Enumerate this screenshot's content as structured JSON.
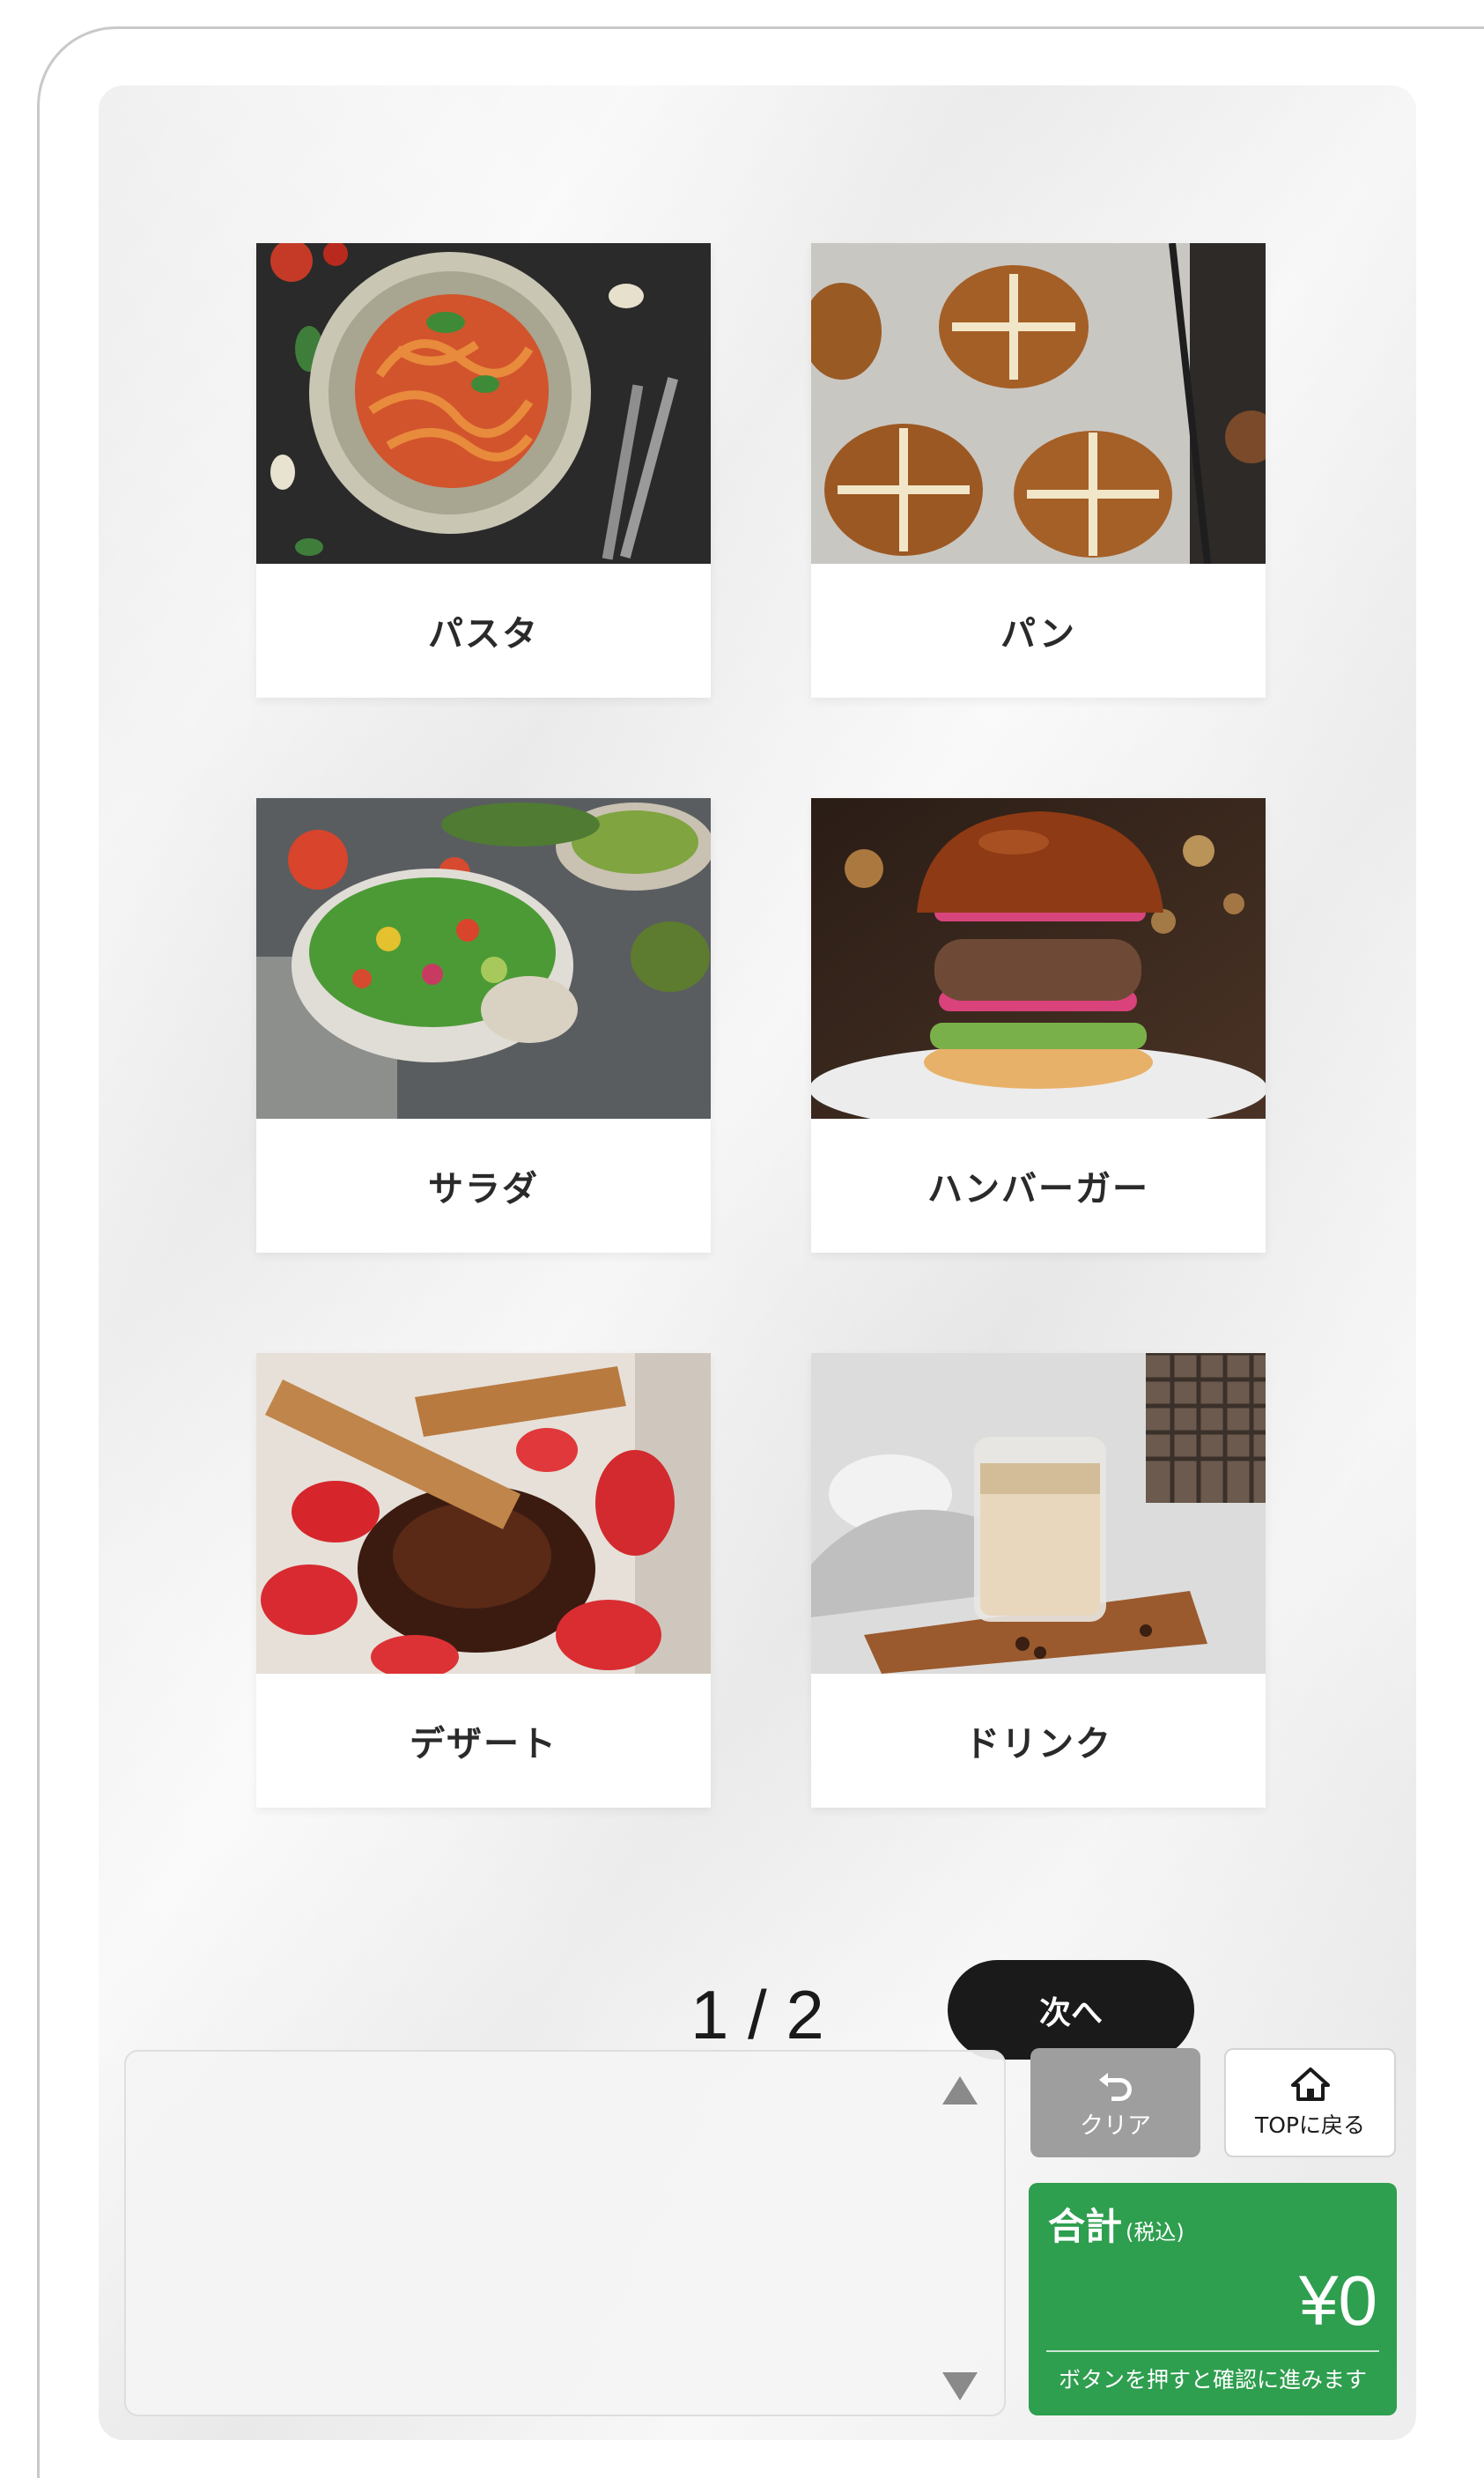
{
  "menu": {
    "categories": [
      {
        "label": "パスタ",
        "icon": "pasta-photo"
      },
      {
        "label": "パン",
        "icon": "bread-photo"
      },
      {
        "label": "サラダ",
        "icon": "salad-photo"
      },
      {
        "label": "ハンバーガー",
        "icon": "hamburger-photo"
      },
      {
        "label": "デザート",
        "icon": "dessert-photo"
      },
      {
        "label": "ドリンク",
        "icon": "drink-photo"
      }
    ]
  },
  "pager": {
    "indicator": "1 / 2",
    "next_label": "次へ"
  },
  "order": {
    "scroll_up_icon": "triangle-up-icon",
    "scroll_down_icon": "triangle-down-icon"
  },
  "actions": {
    "clear_label": "クリア",
    "top_label": "TOPに戻る"
  },
  "total": {
    "label": "合計",
    "tax_note": "(税込)",
    "amount": "¥0",
    "hint": "ボタンを押すと確認に進みます"
  },
  "colors": {
    "total_panel": "#2e9e4f",
    "next_button": "#1a1a1a",
    "clear_button": "#9e9e9e"
  }
}
